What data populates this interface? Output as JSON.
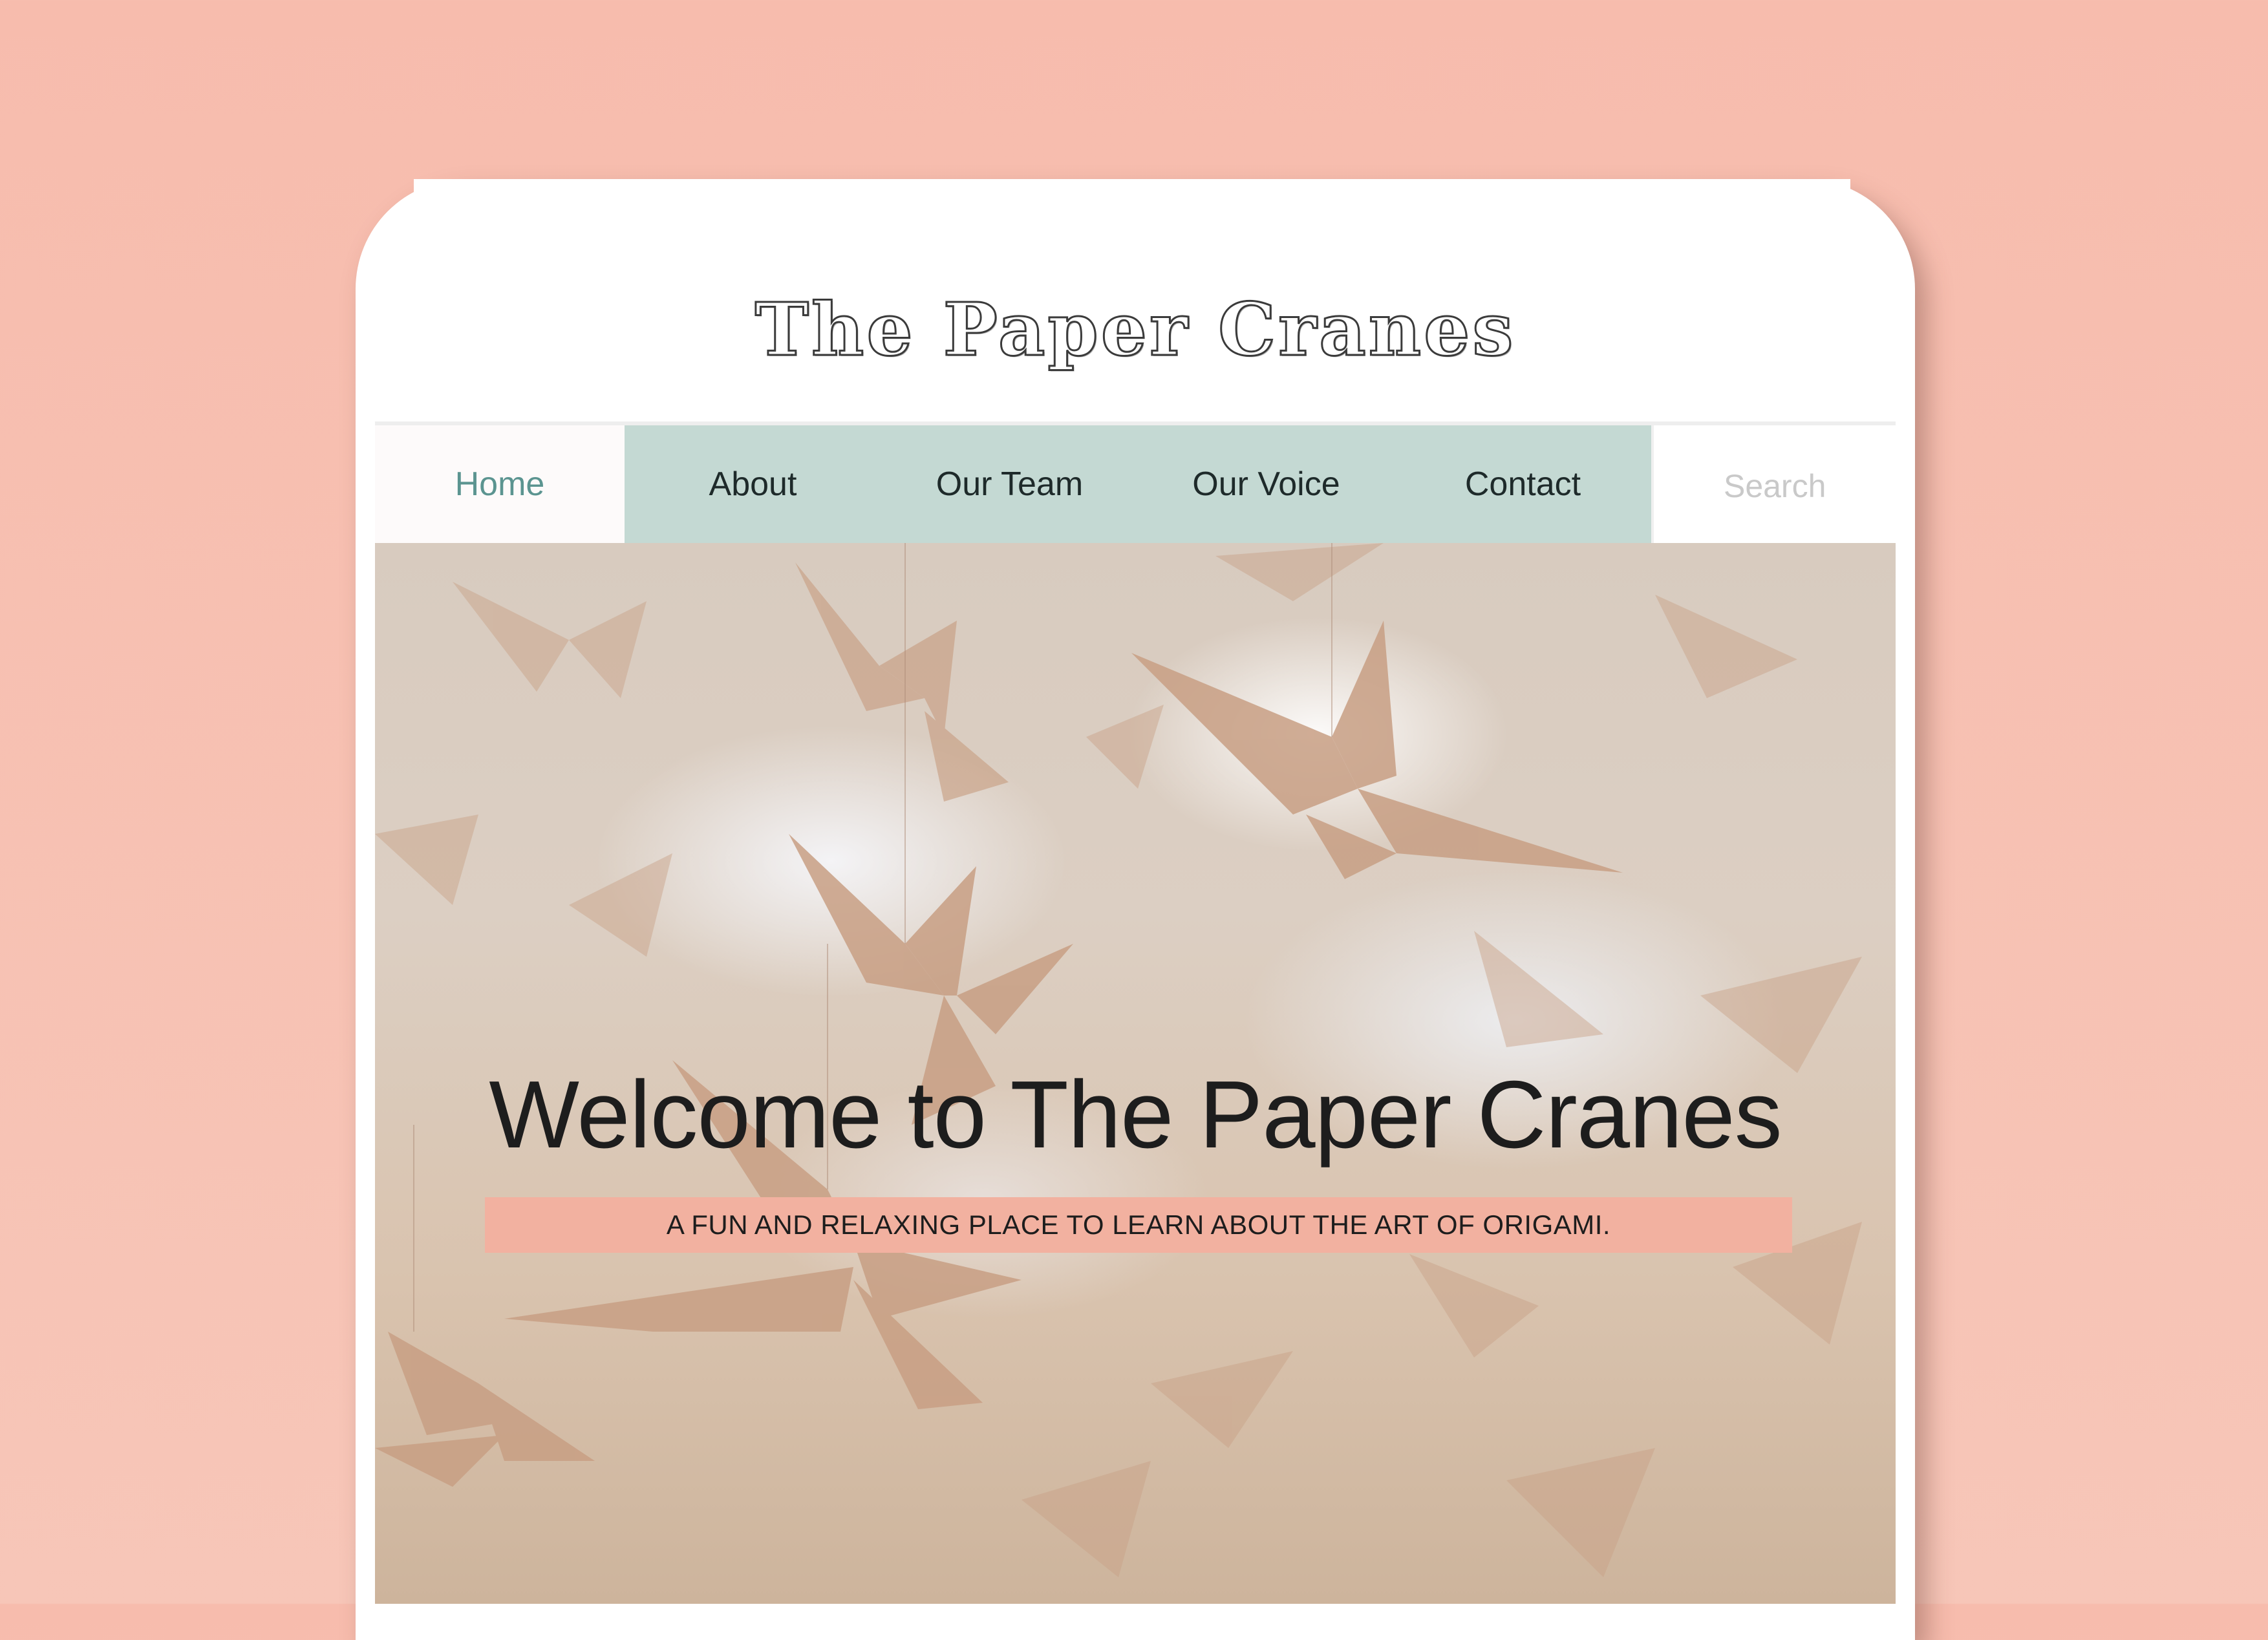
{
  "site": {
    "title": "The Paper Cranes"
  },
  "nav": {
    "items": [
      {
        "label": "Home",
        "active": true
      },
      {
        "label": "About"
      },
      {
        "label": "Our Team"
      },
      {
        "label": "Our Voice"
      },
      {
        "label": "Contact"
      }
    ],
    "search": {
      "placeholder": "Search",
      "value": ""
    }
  },
  "hero": {
    "heading": "Welcome to The Paper Cranes",
    "tagline": "A FUN AND RELAXING PLACE TO LEARN ABOUT THE ART OF ORIGAMI.",
    "image": "origami-paper-cranes-photo"
  },
  "colors": {
    "page_background": "#f7bcad",
    "nav_background": "#c4d9d3",
    "nav_active_text": "#5b9490",
    "banner_background": "#f2b1a0",
    "crane_color": "#c89f84"
  }
}
